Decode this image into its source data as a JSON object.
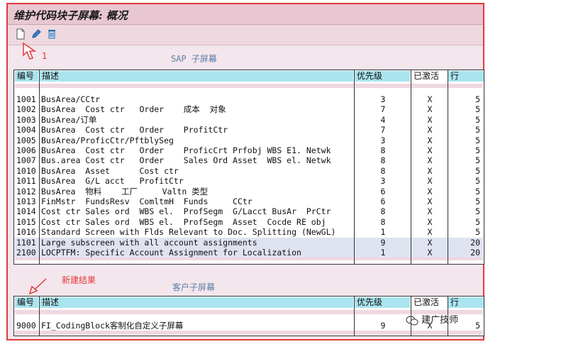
{
  "window": {
    "title": "维护代码块子屏幕: 概况"
  },
  "toolbar": {
    "icons": [
      "new-document-icon",
      "pencil-edit-icon",
      "trash-icon"
    ]
  },
  "annotations": {
    "step1": "1",
    "result": "新建结果"
  },
  "sap_section": {
    "title": "SAP 子屏幕",
    "headers": [
      "编号",
      "描述",
      "优先级",
      "已激活",
      "行"
    ],
    "rows": [
      {
        "no": "1001",
        "desc": "BusArea/CCtr",
        "prio": "3",
        "active": "X",
        "rows": "5",
        "sel": false
      },
      {
        "no": "1002",
        "desc": "BusArea  Cost ctr   Order    成本  对象",
        "prio": "7",
        "active": "X",
        "rows": "5",
        "sel": false
      },
      {
        "no": "1003",
        "desc": "BusArea/订单",
        "prio": "4",
        "active": "X",
        "rows": "5",
        "sel": false
      },
      {
        "no": "1004",
        "desc": "BusArea  Cost ctr   Order    ProfitCtr",
        "prio": "7",
        "active": "X",
        "rows": "5",
        "sel": false
      },
      {
        "no": "1005",
        "desc": "BusArea/ProficCtr/PftblySeg",
        "prio": "3",
        "active": "X",
        "rows": "5",
        "sel": false
      },
      {
        "no": "1006",
        "desc": "BusArea  Cost ctr   Order    ProficCrt Prfobj WBS E1. Netwk",
        "prio": "8",
        "active": "X",
        "rows": "5",
        "sel": false
      },
      {
        "no": "1007",
        "desc": "Bus.area Cost ctr   Order    Sales Ord Asset  WBS el. Netwk",
        "prio": "8",
        "active": "X",
        "rows": "5",
        "sel": false
      },
      {
        "no": "1010",
        "desc": "BusArea  Asset      Cost ctr",
        "prio": "8",
        "active": "X",
        "rows": "5",
        "sel": false
      },
      {
        "no": "1011",
        "desc": "BusArea  G/L acct   ProfitCtr",
        "prio": "3",
        "active": "X",
        "rows": "5",
        "sel": false
      },
      {
        "no": "1012",
        "desc": "BusArea  物料    工厂     Valtn 类型",
        "prio": "6",
        "active": "X",
        "rows": "5",
        "sel": false
      },
      {
        "no": "1013",
        "desc": "FinMstr  FundsResv  ComltmH  Funds     CCtr",
        "prio": "6",
        "active": "X",
        "rows": "5",
        "sel": false
      },
      {
        "no": "1014",
        "desc": "Cost ctr Sales ord  WBS el.  ProfSegm  G/Lacct BusAr  PrCtr",
        "prio": "8",
        "active": "X",
        "rows": "5",
        "sel": false
      },
      {
        "no": "1015",
        "desc": "Cost ctr Sales ord  WBS el.  ProfSegm  Asset  Cocde RE obj",
        "prio": "8",
        "active": "X",
        "rows": "5",
        "sel": false
      },
      {
        "no": "1016",
        "desc": "Standard Screen with Flds Relevant to Doc. Splitting (NewGL)",
        "prio": "1",
        "active": "X",
        "rows": "5",
        "sel": false
      },
      {
        "no": "1101",
        "desc": "Large subscreen with all account assignments",
        "prio": "9",
        "active": "X",
        "rows": "20",
        "sel": true
      },
      {
        "no": "2100",
        "desc": "LOCPTFM: Specific Account Assignment for Localization",
        "prio": "1",
        "active": "X",
        "rows": "20",
        "sel": true
      }
    ]
  },
  "customer_section": {
    "title": "客户子屏幕",
    "headers": [
      "编号",
      "描述",
      "优先级",
      "已激活",
      "行"
    ],
    "rows": [
      {
        "no": "9000",
        "desc": "FI_CodingBlock客制化自定义子屏幕",
        "prio": "9",
        "active": "X",
        "rows": "5"
      }
    ]
  },
  "watermark": "建广技师"
}
